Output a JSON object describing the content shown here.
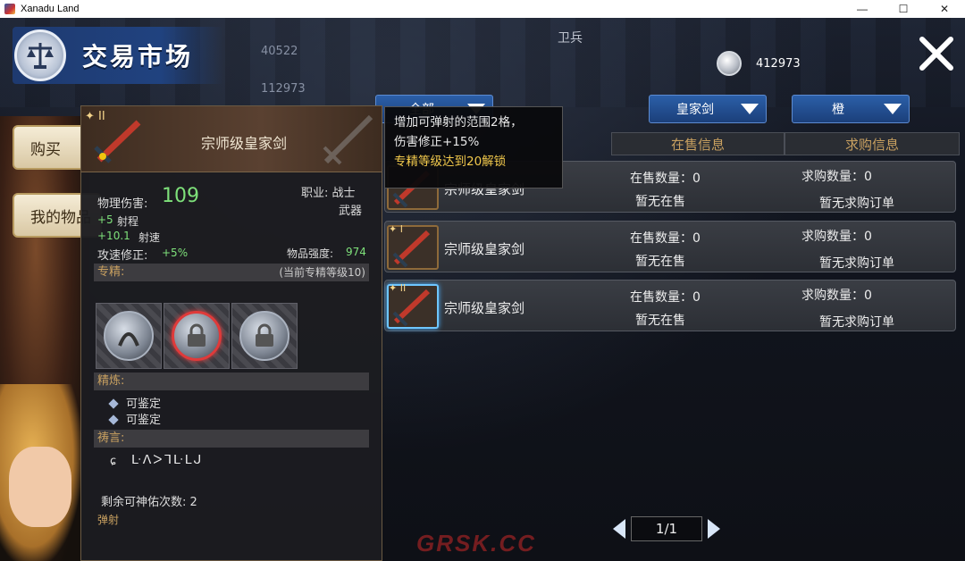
{
  "window": {
    "title": "Xanadu Land",
    "min": "—",
    "max": "☐",
    "close": "✕"
  },
  "header": {
    "title": "交易市场"
  },
  "background": {
    "num1": "40522",
    "num2": "112973",
    "guard": "卫兵"
  },
  "currency": {
    "amount": "412973"
  },
  "sidebar": {
    "buy": "购买",
    "my_items": "我的物品"
  },
  "filters": {
    "category": "全部",
    "weapon_type": "皇家剑",
    "quality": "橙"
  },
  "columns": {
    "on_sale": "在售信息",
    "buy_orders": "求购信息"
  },
  "rows": [
    {
      "tier": "",
      "name": "宗师级皇家剑",
      "sell_count": "在售数量：0",
      "sell_status": "暂无在售",
      "buy_count": "求购数量：0",
      "buy_status": "暂无求购订单"
    },
    {
      "tier": "I",
      "name": "宗师级皇家剑",
      "sell_count": "在售数量：0",
      "sell_status": "暂无在售",
      "buy_count": "求购数量：0",
      "buy_status": "暂无求购订单"
    },
    {
      "tier": "II",
      "name": "宗师级皇家剑",
      "sell_count": "在售数量：0",
      "sell_status": "暂无在售",
      "buy_count": "求购数量：0",
      "buy_status": "暂无求购订单"
    }
  ],
  "tooltip": {
    "line1": "增加可弹射的范围2格，",
    "line2": "伤害修正+15%",
    "line3": "专精等级达到20解锁",
    "line3_color": "#f2c94c"
  },
  "item": {
    "tier": "II",
    "name": "宗师级皇家剑",
    "phys_label": "物理伤害:",
    "phys_value": "109",
    "class": "职业: 战士",
    "type": "武器",
    "bonus1_val": "+5",
    "bonus1_label": "射程",
    "bonus2_val": "+10.1",
    "bonus2_label": "射速",
    "atk_speed_label": "攻速修正:",
    "atk_speed_val": "+5%",
    "strength_label": "物品强度:",
    "strength_val": "974",
    "spec_label": "专精:",
    "spec_level": "(当前专精等级10)",
    "refine_label": "精炼:",
    "refine1": "可鉴定",
    "refine2": "可鉴定",
    "prayer_label": "祷言:",
    "prayer_rune": "ᒷᐱᐳᒣᒷᒪᒍ",
    "blessings": "剩余可神佑次数: 2",
    "skill": "弹射"
  },
  "pager": {
    "page": "1/1"
  },
  "watermark": "GRSK.CC",
  "colors": {
    "accent_blue": "#2b5fa8",
    "gold": "#c8a060",
    "green": "#7ee07a",
    "selected": "#6ec6ff"
  }
}
